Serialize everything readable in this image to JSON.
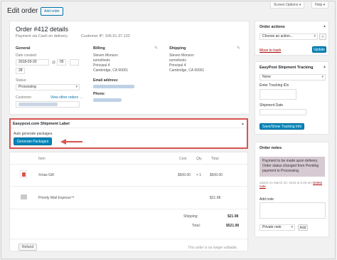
{
  "header": {
    "title": "Edit order",
    "add_order": "Add order",
    "screen_options": "Screen Options ▾",
    "help": "Help ▾"
  },
  "order": {
    "title": "Order #412 details",
    "payment": "Payment via Cash on delivery.",
    "customer_ip_label": "Customer IP:",
    "customer_ip": "106.51.37.132",
    "general": {
      "heading": "General",
      "date_created_label": "Date created:",
      "date": "2018-03-20",
      "hour": "05",
      "minute": "28",
      "status_label": "Status:",
      "status": "Processing",
      "customer_label": "Customer:",
      "customer_profile_link": "Profile →",
      "view_other_orders": "View other orders →"
    },
    "billing": {
      "heading": "Billing",
      "lines": [
        "Steven Monson",
        "ezmeltools",
        "Principal 4",
        "Cambridge, CA 90001"
      ],
      "email_label": "Email address:",
      "phone_label": "Phone:"
    },
    "shipping": {
      "heading": "Shipping",
      "lines": [
        "Steven Monson",
        "ezmeltools",
        "Principal 4",
        "Cambridge, CA 90001"
      ]
    }
  },
  "easypost": {
    "heading": "Easypost.com Shipment Label",
    "auto_text": "Auto generate packages.",
    "generate_button": "Generate Packages"
  },
  "items": {
    "headers": {
      "item": "Item",
      "cost": "Cost",
      "qty": "Qty",
      "total": "Total"
    },
    "line_item": {
      "name": "Xmas Gift",
      "cost": "$500.00",
      "qty": "× 1",
      "total": "$500.00"
    },
    "shipping_line": {
      "name": "Priority Mail Express™",
      "total": "$21.98"
    },
    "summary": {
      "shipping_label": "Shipping:",
      "shipping_value": "$21.98",
      "total_label": "Total:",
      "total_value": "$521.98"
    },
    "refund_button": "Refund",
    "not_editable": "This order is no longer editable."
  },
  "actions": {
    "heading": "Order actions",
    "select_placeholder": "Choose an action...",
    "go": "›",
    "trash": "Move to trash",
    "update": "Update"
  },
  "tracking": {
    "heading": "EasyPost Shipment Tracking",
    "provider": "None",
    "ids_label": "Enter Tracking IDs",
    "date_label": "Shipment Date",
    "button": "Save/Show Tracking Info"
  },
  "notes": {
    "heading": "Order notes",
    "note_text": "Payment to be made upon delivery. Order status changed from Pending payment to Processing.",
    "note_date": "added on March 20, 2018 at 5:28 am",
    "delete_note": "Delete note",
    "add_note_label": "Add note",
    "note_type": "Private note",
    "add": "Add"
  },
  "icons": {
    "pencil": "pencil-icon",
    "caret": "caret-up-icon",
    "gift": "gift-icon",
    "truck": "truck-icon",
    "arrow": "arrow-left-icon"
  },
  "colors": {
    "primary": "#0085ba",
    "highlight": "#d9534f",
    "link": "#0073aa",
    "note_bg": "#d7cad2"
  }
}
